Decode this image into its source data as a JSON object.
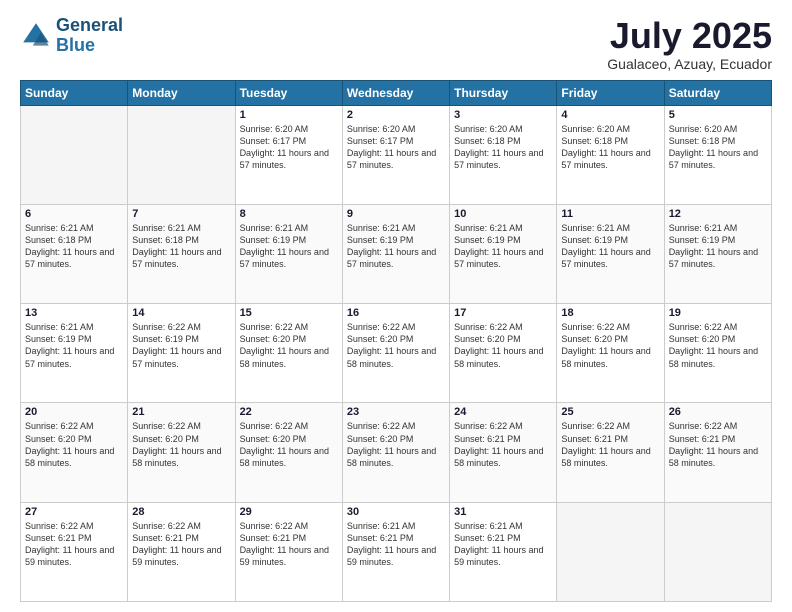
{
  "logo": {
    "line1": "General",
    "line2": "Blue"
  },
  "title": "July 2025",
  "subtitle": "Gualaceo, Azuay, Ecuador",
  "headers": [
    "Sunday",
    "Monday",
    "Tuesday",
    "Wednesday",
    "Thursday",
    "Friday",
    "Saturday"
  ],
  "weeks": [
    [
      {
        "day": "",
        "sunrise": "",
        "sunset": "",
        "daylight": ""
      },
      {
        "day": "",
        "sunrise": "",
        "sunset": "",
        "daylight": ""
      },
      {
        "day": "1",
        "sunrise": "Sunrise: 6:20 AM",
        "sunset": "Sunset: 6:17 PM",
        "daylight": "Daylight: 11 hours and 57 minutes."
      },
      {
        "day": "2",
        "sunrise": "Sunrise: 6:20 AM",
        "sunset": "Sunset: 6:17 PM",
        "daylight": "Daylight: 11 hours and 57 minutes."
      },
      {
        "day": "3",
        "sunrise": "Sunrise: 6:20 AM",
        "sunset": "Sunset: 6:18 PM",
        "daylight": "Daylight: 11 hours and 57 minutes."
      },
      {
        "day": "4",
        "sunrise": "Sunrise: 6:20 AM",
        "sunset": "Sunset: 6:18 PM",
        "daylight": "Daylight: 11 hours and 57 minutes."
      },
      {
        "day": "5",
        "sunrise": "Sunrise: 6:20 AM",
        "sunset": "Sunset: 6:18 PM",
        "daylight": "Daylight: 11 hours and 57 minutes."
      }
    ],
    [
      {
        "day": "6",
        "sunrise": "Sunrise: 6:21 AM",
        "sunset": "Sunset: 6:18 PM",
        "daylight": "Daylight: 11 hours and 57 minutes."
      },
      {
        "day": "7",
        "sunrise": "Sunrise: 6:21 AM",
        "sunset": "Sunset: 6:18 PM",
        "daylight": "Daylight: 11 hours and 57 minutes."
      },
      {
        "day": "8",
        "sunrise": "Sunrise: 6:21 AM",
        "sunset": "Sunset: 6:19 PM",
        "daylight": "Daylight: 11 hours and 57 minutes."
      },
      {
        "day": "9",
        "sunrise": "Sunrise: 6:21 AM",
        "sunset": "Sunset: 6:19 PM",
        "daylight": "Daylight: 11 hours and 57 minutes."
      },
      {
        "day": "10",
        "sunrise": "Sunrise: 6:21 AM",
        "sunset": "Sunset: 6:19 PM",
        "daylight": "Daylight: 11 hours and 57 minutes."
      },
      {
        "day": "11",
        "sunrise": "Sunrise: 6:21 AM",
        "sunset": "Sunset: 6:19 PM",
        "daylight": "Daylight: 11 hours and 57 minutes."
      },
      {
        "day": "12",
        "sunrise": "Sunrise: 6:21 AM",
        "sunset": "Sunset: 6:19 PM",
        "daylight": "Daylight: 11 hours and 57 minutes."
      }
    ],
    [
      {
        "day": "13",
        "sunrise": "Sunrise: 6:21 AM",
        "sunset": "Sunset: 6:19 PM",
        "daylight": "Daylight: 11 hours and 57 minutes."
      },
      {
        "day": "14",
        "sunrise": "Sunrise: 6:22 AM",
        "sunset": "Sunset: 6:19 PM",
        "daylight": "Daylight: 11 hours and 57 minutes."
      },
      {
        "day": "15",
        "sunrise": "Sunrise: 6:22 AM",
        "sunset": "Sunset: 6:20 PM",
        "daylight": "Daylight: 11 hours and 58 minutes."
      },
      {
        "day": "16",
        "sunrise": "Sunrise: 6:22 AM",
        "sunset": "Sunset: 6:20 PM",
        "daylight": "Daylight: 11 hours and 58 minutes."
      },
      {
        "day": "17",
        "sunrise": "Sunrise: 6:22 AM",
        "sunset": "Sunset: 6:20 PM",
        "daylight": "Daylight: 11 hours and 58 minutes."
      },
      {
        "day": "18",
        "sunrise": "Sunrise: 6:22 AM",
        "sunset": "Sunset: 6:20 PM",
        "daylight": "Daylight: 11 hours and 58 minutes."
      },
      {
        "day": "19",
        "sunrise": "Sunrise: 6:22 AM",
        "sunset": "Sunset: 6:20 PM",
        "daylight": "Daylight: 11 hours and 58 minutes."
      }
    ],
    [
      {
        "day": "20",
        "sunrise": "Sunrise: 6:22 AM",
        "sunset": "Sunset: 6:20 PM",
        "daylight": "Daylight: 11 hours and 58 minutes."
      },
      {
        "day": "21",
        "sunrise": "Sunrise: 6:22 AM",
        "sunset": "Sunset: 6:20 PM",
        "daylight": "Daylight: 11 hours and 58 minutes."
      },
      {
        "day": "22",
        "sunrise": "Sunrise: 6:22 AM",
        "sunset": "Sunset: 6:20 PM",
        "daylight": "Daylight: 11 hours and 58 minutes."
      },
      {
        "day": "23",
        "sunrise": "Sunrise: 6:22 AM",
        "sunset": "Sunset: 6:20 PM",
        "daylight": "Daylight: 11 hours and 58 minutes."
      },
      {
        "day": "24",
        "sunrise": "Sunrise: 6:22 AM",
        "sunset": "Sunset: 6:21 PM",
        "daylight": "Daylight: 11 hours and 58 minutes."
      },
      {
        "day": "25",
        "sunrise": "Sunrise: 6:22 AM",
        "sunset": "Sunset: 6:21 PM",
        "daylight": "Daylight: 11 hours and 58 minutes."
      },
      {
        "day": "26",
        "sunrise": "Sunrise: 6:22 AM",
        "sunset": "Sunset: 6:21 PM",
        "daylight": "Daylight: 11 hours and 58 minutes."
      }
    ],
    [
      {
        "day": "27",
        "sunrise": "Sunrise: 6:22 AM",
        "sunset": "Sunset: 6:21 PM",
        "daylight": "Daylight: 11 hours and 59 minutes."
      },
      {
        "day": "28",
        "sunrise": "Sunrise: 6:22 AM",
        "sunset": "Sunset: 6:21 PM",
        "daylight": "Daylight: 11 hours and 59 minutes."
      },
      {
        "day": "29",
        "sunrise": "Sunrise: 6:22 AM",
        "sunset": "Sunset: 6:21 PM",
        "daylight": "Daylight: 11 hours and 59 minutes."
      },
      {
        "day": "30",
        "sunrise": "Sunrise: 6:21 AM",
        "sunset": "Sunset: 6:21 PM",
        "daylight": "Daylight: 11 hours and 59 minutes."
      },
      {
        "day": "31",
        "sunrise": "Sunrise: 6:21 AM",
        "sunset": "Sunset: 6:21 PM",
        "daylight": "Daylight: 11 hours and 59 minutes."
      },
      {
        "day": "",
        "sunrise": "",
        "sunset": "",
        "daylight": ""
      },
      {
        "day": "",
        "sunrise": "",
        "sunset": "",
        "daylight": ""
      }
    ]
  ]
}
